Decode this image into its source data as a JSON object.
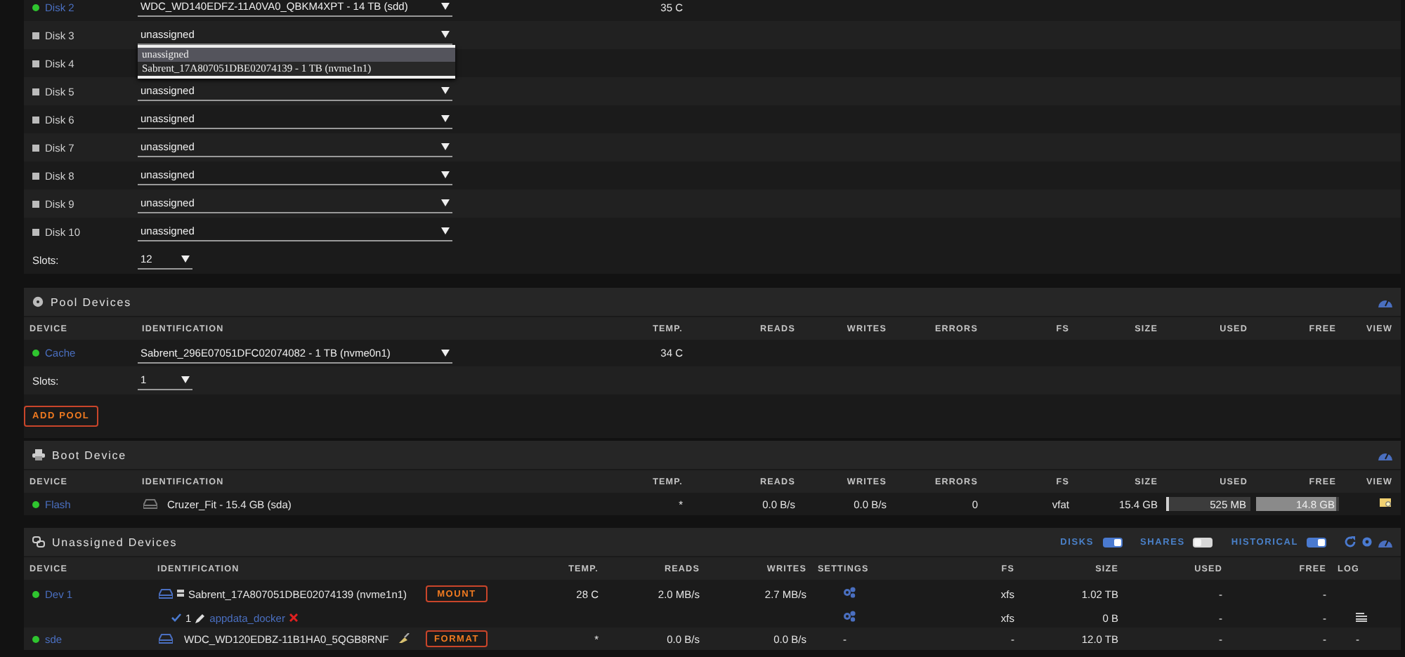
{
  "array_devices": [
    {
      "device": "Disk 2",
      "online": true,
      "identification": "WDC_WD140EDFZ-11A0VA0_QBKM4XPT - 14 TB (sdd)",
      "temp": "35 C"
    },
    {
      "device": "Disk 3",
      "online": false,
      "identification": "unassigned",
      "dropdown": [
        {
          "label": "unassigned",
          "selected": true
        },
        {
          "label": "Sabrent_17A807051DBE02074139 - 1 TB (nvme1n1)",
          "selected": false
        }
      ]
    },
    {
      "device": "Disk 4",
      "online": false
    },
    {
      "device": "Disk 5",
      "online": false,
      "identification": "unassigned"
    },
    {
      "device": "Disk 6",
      "online": false,
      "identification": "unassigned"
    },
    {
      "device": "Disk 7",
      "online": false,
      "identification": "unassigned"
    },
    {
      "device": "Disk 8",
      "online": false,
      "identification": "unassigned"
    },
    {
      "device": "Disk 9",
      "online": false,
      "identification": "unassigned"
    },
    {
      "device": "Disk 10",
      "online": false,
      "identification": "unassigned"
    }
  ],
  "array_slots": {
    "label": "Slots:",
    "value": "12"
  },
  "pool_devices": {
    "title": "Pool Devices",
    "columns": [
      "DEVICE",
      "IDENTIFICATION",
      "TEMP.",
      "READS",
      "WRITES",
      "ERRORS",
      "FS",
      "SIZE",
      "USED",
      "FREE",
      "VIEW"
    ],
    "rows": [
      {
        "device": "Cache",
        "online": true,
        "identification": "Sabrent_296E07051DFC02074082 - 1 TB (nvme0n1)",
        "temp": "34 C"
      }
    ],
    "slots": {
      "label": "Slots:",
      "value": "1"
    },
    "add_button": "ADD POOL"
  },
  "boot_device": {
    "title": "Boot Device",
    "columns": [
      "DEVICE",
      "IDENTIFICATION",
      "TEMP.",
      "READS",
      "WRITES",
      "ERRORS",
      "FS",
      "SIZE",
      "USED",
      "FREE",
      "VIEW"
    ],
    "rows": [
      {
        "device": "Flash",
        "online": true,
        "identification": "Cruzer_Fit - 15.4 GB (sda)",
        "temp": "*",
        "reads": "0.0 B/s",
        "writes": "0.0 B/s",
        "errors": "0",
        "fs": "vfat",
        "size": "15.4 GB",
        "used": {
          "text": "525 MB",
          "level": 0.03
        },
        "free": {
          "text": "14.8 GB",
          "level": 0.97
        }
      }
    ]
  },
  "unassigned_devices": {
    "title": "Unassigned Devices",
    "toggles": [
      {
        "label": "DISKS",
        "on": true
      },
      {
        "label": "SHARES",
        "on": false
      },
      {
        "label": "HISTORICAL",
        "on": true
      }
    ],
    "columns": [
      "DEVICE",
      "IDENTIFICATION",
      "TEMP.",
      "READS",
      "WRITES",
      "SETTINGS",
      "FS",
      "SIZE",
      "USED",
      "FREE",
      "LOG"
    ],
    "rows": [
      {
        "device": "Dev 1",
        "online": true,
        "identification": "Sabrent_17A807051DBE02074139 (nvme1n1)",
        "action": "MOUNT",
        "temp": "28 C",
        "reads": "2.0 MB/s",
        "writes": "2.7 MB/s",
        "settings_icon": true,
        "fs": "xfs",
        "size": "1.02 TB",
        "used": "-",
        "free": "-",
        "partitions": [
          {
            "number": "1",
            "name": "appdata_docker",
            "fs": "xfs",
            "size": "0 B",
            "used": "-",
            "free": "-"
          }
        ]
      },
      {
        "device": "sde",
        "online": true,
        "identification": "WDC_WD120EDBZ-11B1HA0_5QGB8RNF",
        "action": "FORMAT",
        "temp": "*",
        "reads": "0.0 B/s",
        "writes": "0.0 B/s",
        "settings": "-",
        "fs": "-",
        "size": "12.0 TB",
        "used": "-",
        "free": "-",
        "log": "-"
      }
    ]
  }
}
